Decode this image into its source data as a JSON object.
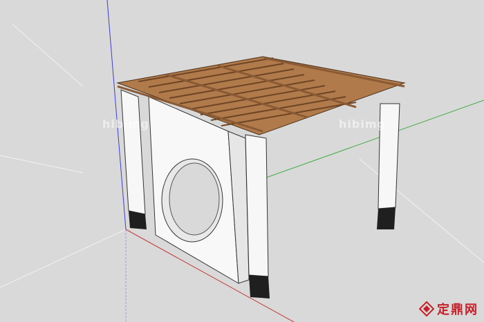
{
  "viewport": {
    "background": "#d9d9d9",
    "axis_colors": {
      "blue": "#3b3bd6",
      "green": "#3faa3f",
      "red": "#c23b3b"
    }
  },
  "model": {
    "roof_color": "#8a5a34",
    "wall_color": "#f7f7f7",
    "footing_color": "#1f1f1f"
  },
  "watermarks": [
    "hibimg",
    "hibimg"
  ],
  "brand": {
    "logo_icon": "diamond-logo-icon",
    "text": "定鼎网",
    "color": "#c61f27"
  }
}
